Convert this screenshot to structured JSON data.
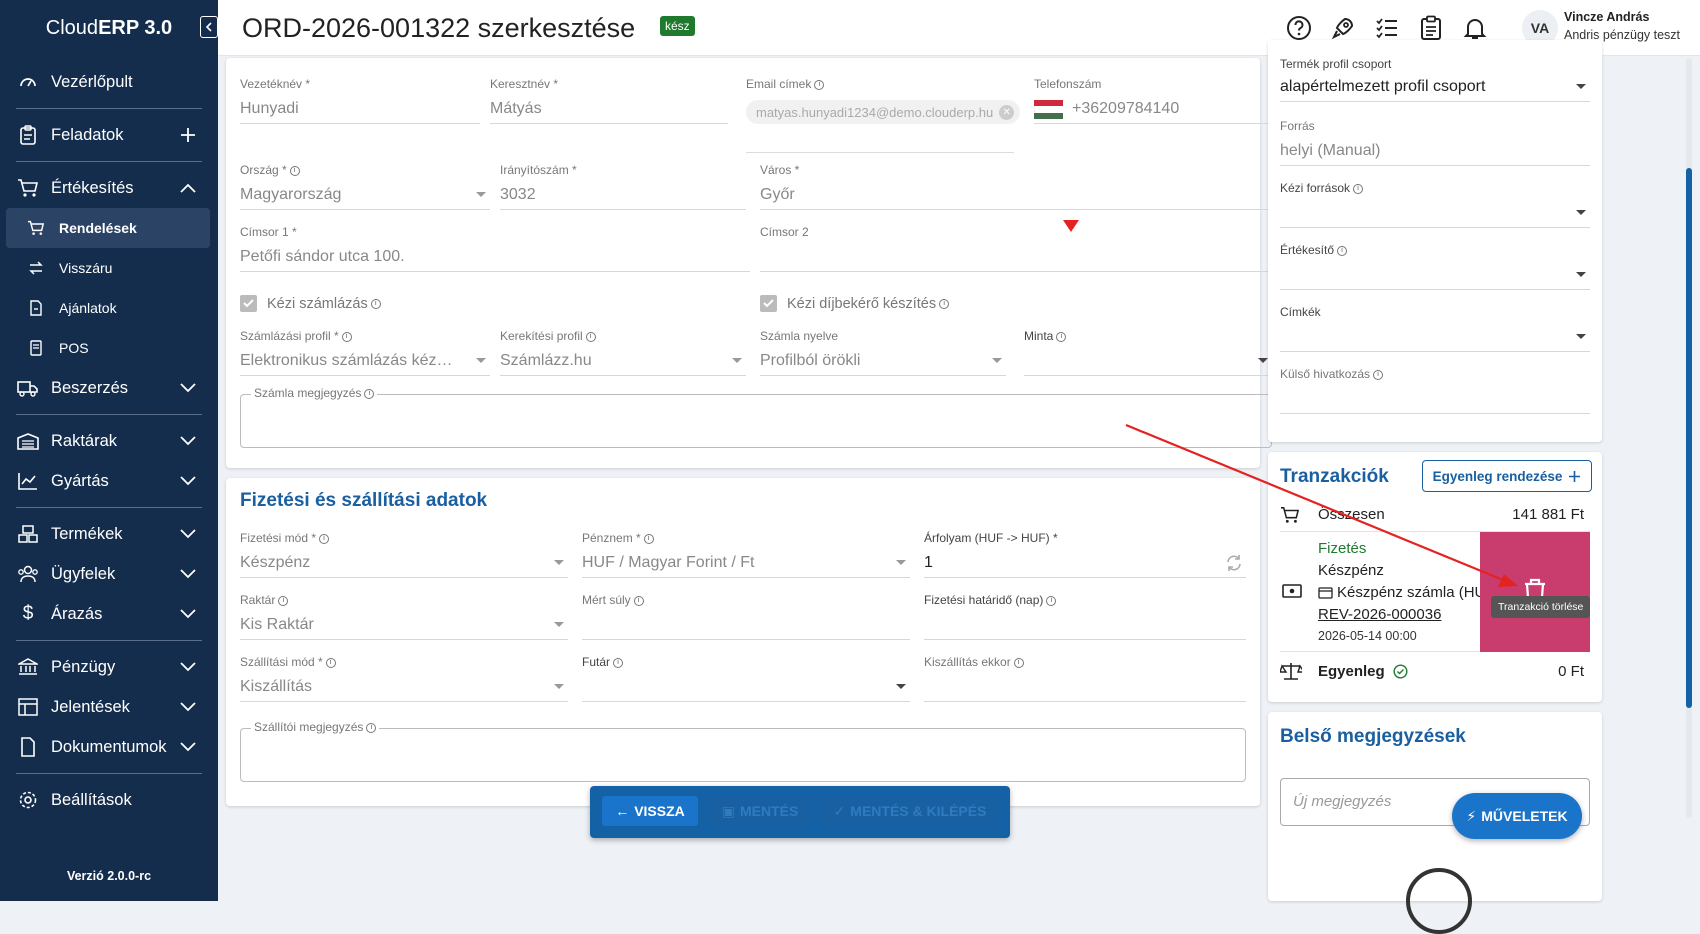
{
  "sidebar": {
    "brand_prefix": "Cloud",
    "brand_bold": "ERP 3.0",
    "items": {
      "dashboard": "Vezérlőpult",
      "tasks": "Feladatok",
      "sales": "Értékesítés",
      "orders": "Rendelések",
      "returns": "Visszáru",
      "offers": "Ajánlatok",
      "pos": "POS",
      "purchase": "Beszerzés",
      "warehouses": "Raktárak",
      "production": "Gyártás",
      "products": "Termékek",
      "customers": "Ügyfelek",
      "pricing": "Árazás",
      "finance": "Pénzügy",
      "reports": "Jelentések",
      "documents": "Dokumentumok",
      "settings": "Beállítások"
    },
    "version": "Verzió 2.0.0-rc"
  },
  "header": {
    "title": "ORD-2026-001322 szerkesztése",
    "badge": "kész",
    "user_name": "Vincze András",
    "user_role": "Andris pénzügy teszt",
    "avatar": "VA"
  },
  "customer": {
    "lastname_label": "Vezetéknév *",
    "lastname": "Hunyadi",
    "firstname_label": "Keresztnév *",
    "firstname": "Mátyás",
    "email_label": "Email címek",
    "email_chip": "matyas.hunyadi1234@demo.clouderp.hu",
    "phone_label": "Telefonszám",
    "phone": "+36209784140",
    "country_label": "Ország *",
    "country": "Magyarország",
    "zip_label": "Irányítószám *",
    "zip": "3032",
    "city_label": "Város *",
    "city": "Győr",
    "addr1_label": "Címsor 1 *",
    "addr1": "Petőfi sándor utca 100.",
    "addr2_label": "Címsor 2",
    "addr2": "",
    "manual_invoice": "Kézi számlázás",
    "manual_proforma": "Kézi díjbekérő készítés",
    "invoice_profile_label": "Számlázási profil *",
    "invoice_profile": "Elektronikus számlázás kéz…",
    "rounding_label": "Kerekítési profil",
    "rounding": "Számlázz.hu",
    "lang_label": "Számla nyelve",
    "lang": "Profilból örökli",
    "sample_label": "Minta",
    "sample": "",
    "invoice_note_label": "Számla megjegyzés"
  },
  "payment": {
    "title": "Fizetési és szállítási adatok",
    "method_label": "Fizetési mód *",
    "method": "Készpénz",
    "currency_label": "Pénznem *",
    "currency": "HUF / Magyar Forint / Ft",
    "rate_label": "Árfolyam (HUF -> HUF) *",
    "rate": "1",
    "warehouse_label": "Raktár",
    "warehouse": "Kis Raktár",
    "weight_label": "Mért súly",
    "weight": "",
    "deadline_label": "Fizetési határidő (nap)",
    "deadline": "",
    "shipping_label": "Szállítási mód *",
    "shipping": "Kiszállítás",
    "courier_label": "Futár",
    "courier": "",
    "ship_when_label": "Kiszállítás ekkor",
    "ship_when": "",
    "ship_note_label": "Szállítói megjegyzés"
  },
  "side": {
    "profile_group_label": "Termék profil csoport",
    "profile_group": "alapértelmezett profil csoport",
    "source_label": "Forrás",
    "source": "helyi (Manual)",
    "manual_sources_label": "Kézi források",
    "seller_label": "Értékesítő",
    "tags_label": "Címkék",
    "ext_ref_label": "Külső hivatkozás"
  },
  "transactions": {
    "title": "Tranzakciók",
    "add_button": "Egyenleg rendezése",
    "total_label": "Összesen",
    "total": "141 881 Ft",
    "pay_type": "Fizetés",
    "pay_method": "Készpénz",
    "pay_doc": "Készpénz számla (HU",
    "pay_ref": "REV-2026-000036",
    "pay_date": "2026-05-14 00:00",
    "balance_label": "Egyenleg",
    "balance": "0 Ft",
    "tooltip": "Tranzakció törlése"
  },
  "notes": {
    "title": "Belső megjegyzések",
    "placeholder": "Új megjegyzés"
  },
  "actions": {
    "back": "VISSZA",
    "save": "MENTÉS",
    "save_exit": "MENTÉS & KILÉPÉS",
    "ops": "MŰVELETEK"
  },
  "colors": {
    "sidebar": "#142d4c",
    "accent": "#1a5fa0",
    "delete": "#c83d6e",
    "success": "#1f7a2e"
  }
}
